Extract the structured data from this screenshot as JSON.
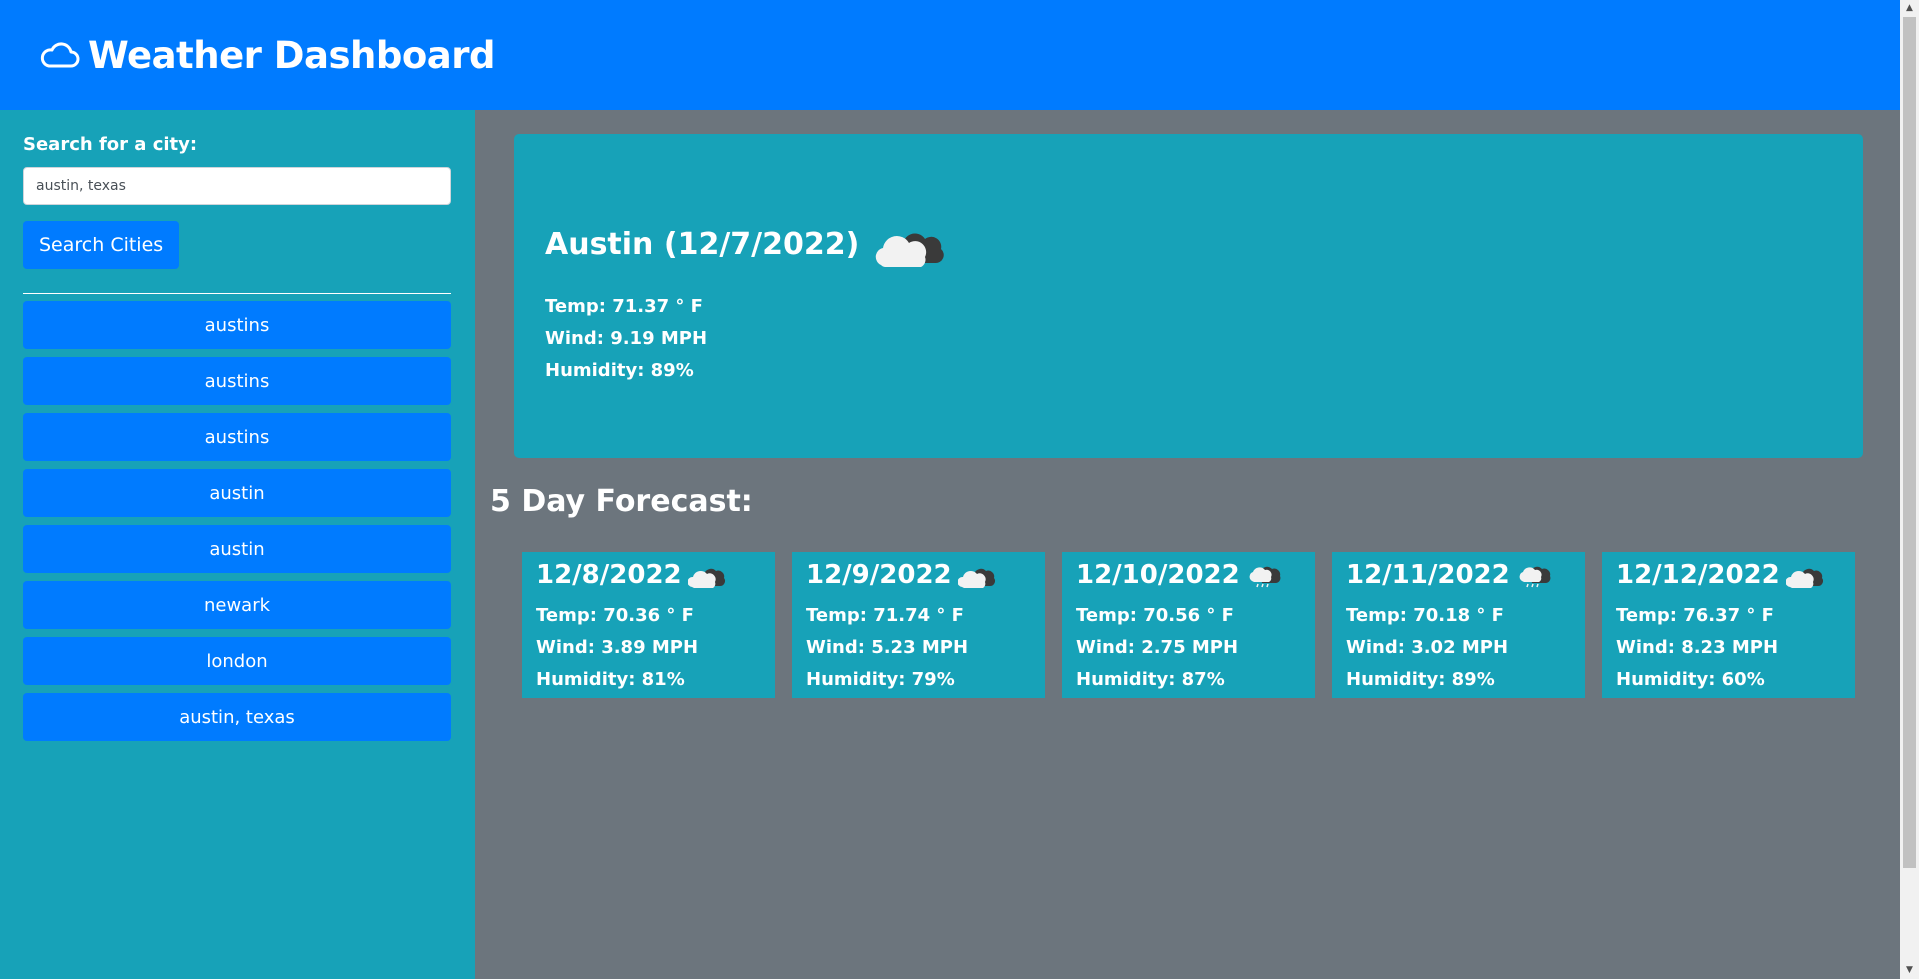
{
  "header": {
    "title": "Weather Dashboard",
    "icon": "cloud-icon"
  },
  "sidebar": {
    "search_label": "Search for a city:",
    "search_value": "austin, texas",
    "search_button": "Search Cities",
    "history": [
      "austins",
      "austins",
      "austins",
      "austin",
      "austin",
      "newark",
      "london",
      "austin, texas"
    ]
  },
  "current": {
    "title": "Austin (12/7/2022)",
    "icon": "cloudy-icon",
    "temp": "Temp: 71.37 ° F",
    "wind": "Wind: 9.19 MPH",
    "humidity": "Humidity: 89%"
  },
  "forecast": {
    "title": "5 Day Forecast:",
    "days": [
      {
        "date": "12/8/2022",
        "icon": "cloudy-icon",
        "temp": "Temp: 70.36 ° F",
        "wind": "Wind: 3.89 MPH",
        "humidity": "Humidity: 81%"
      },
      {
        "date": "12/9/2022",
        "icon": "cloudy-icon",
        "temp": "Temp: 71.74 ° F",
        "wind": "Wind: 5.23 MPH",
        "humidity": "Humidity: 79%"
      },
      {
        "date": "12/10/2022",
        "icon": "rain-icon",
        "temp": "Temp: 70.56 ° F",
        "wind": "Wind: 2.75 MPH",
        "humidity": "Humidity: 87%"
      },
      {
        "date": "12/11/2022",
        "icon": "rain-icon",
        "temp": "Temp: 70.18 ° F",
        "wind": "Wind: 3.02 MPH",
        "humidity": "Humidity: 89%"
      },
      {
        "date": "12/12/2022",
        "icon": "cloudy-icon",
        "temp": "Temp: 76.37 ° F",
        "wind": "Wind: 8.23 MPH",
        "humidity": "Humidity: 60%"
      }
    ]
  },
  "colors": {
    "primary": "#007bff",
    "info": "#17a2b8",
    "secondary": "#6c757d"
  }
}
